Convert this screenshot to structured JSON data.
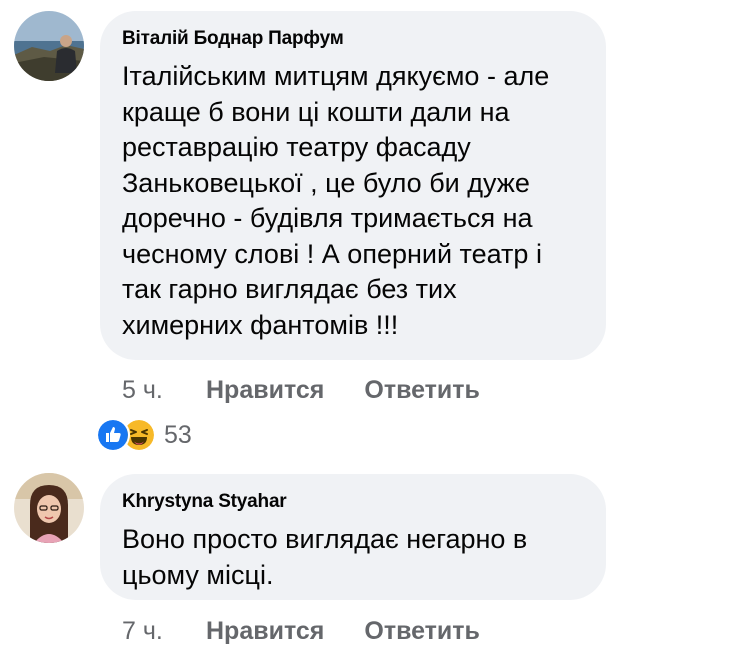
{
  "comments": [
    {
      "author": "Віталій Боднар Парфум",
      "text": "Італійським митцям дякуємо - але\nкраще б вони ці кошти дали на\nреставрацію театру фасаду\nЗаньковецької , це було би дуже\nдоречно - будівля тримається на\nчесному слові ! А оперний театр і\nтак гарно виглядає без тих\nхимерних фантомів !!!",
      "time": "5 ч.",
      "like_label": "Нравится",
      "reply_label": "Ответить",
      "reaction_count": "53",
      "reactions": [
        "like-icon",
        "haha-icon"
      ]
    },
    {
      "author": "Khrystyna Styahar",
      "text": "Воно просто виглядає негарно в\nцьому місці.",
      "time": "7 ч.",
      "like_label": "Нравится",
      "reply_label": "Ответить"
    }
  ],
  "colors": {
    "bubble": "#f0f2f5",
    "meta_text": "#65676b",
    "like_blue": "#1877f2",
    "haha_yellow": "#f7b928"
  }
}
